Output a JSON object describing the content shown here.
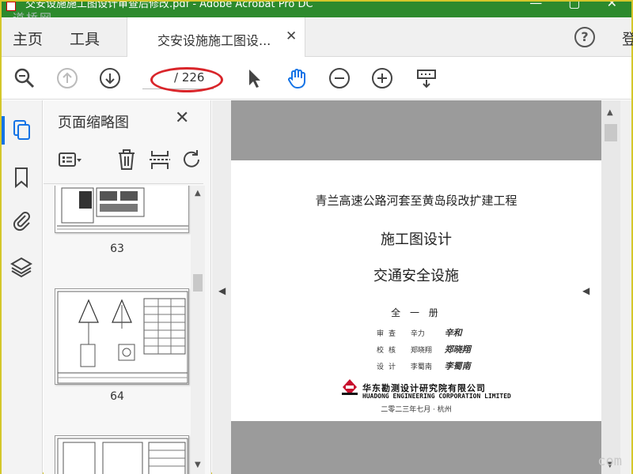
{
  "window": {
    "title": "交安设施施工图设计审查后修改.pdf - Adobe Acrobat Pro DC",
    "controls": "—  ▢  ✕"
  },
  "watermarks": {
    "top_left": "道桥网",
    "bottom_right": "com"
  },
  "menu": {
    "home": "主页",
    "tools": "工具",
    "login": "登"
  },
  "tab": {
    "label": "交安设施施工图设...",
    "close": "✕"
  },
  "help": {
    "label": "?"
  },
  "toolbar": {
    "page_current": "",
    "page_total": "/ 226",
    "icons": [
      "zoom-out-search-icon",
      "prev-page-icon",
      "next-page-icon",
      "select-arrow-icon",
      "hand-tool-icon",
      "zoom-out-icon",
      "zoom-in-icon",
      "page-display-icon"
    ]
  },
  "thumbnails_panel": {
    "title": "页面缩略图",
    "close": "✕",
    "pages": [
      {
        "label": "63"
      },
      {
        "label": "64"
      },
      {
        "label": ""
      }
    ]
  },
  "document": {
    "project": "青兰高速公路河套至黄岛段改扩建工程",
    "title1": "施工图设计",
    "title2": "交通安全设施",
    "volume": "全 一 册",
    "signers": [
      {
        "role": "审查",
        "name": "辛力",
        "signature": "辛和"
      },
      {
        "role": "校核",
        "name": "郑晓翔",
        "signature": "郑晓翔"
      },
      {
        "role": "设计",
        "name": "李蜀南",
        "signature": "李蜀南"
      }
    ],
    "company": "华东勘测设计研究院有限公司",
    "company_en": "HUADONG ENGINEERING CORPORATION LIMITED",
    "date": "二零二三年七月 · 杭州"
  },
  "colors": {
    "titlebar": "#2d8a2d",
    "accent": "#1473e6",
    "annotation": "#d9252a"
  }
}
